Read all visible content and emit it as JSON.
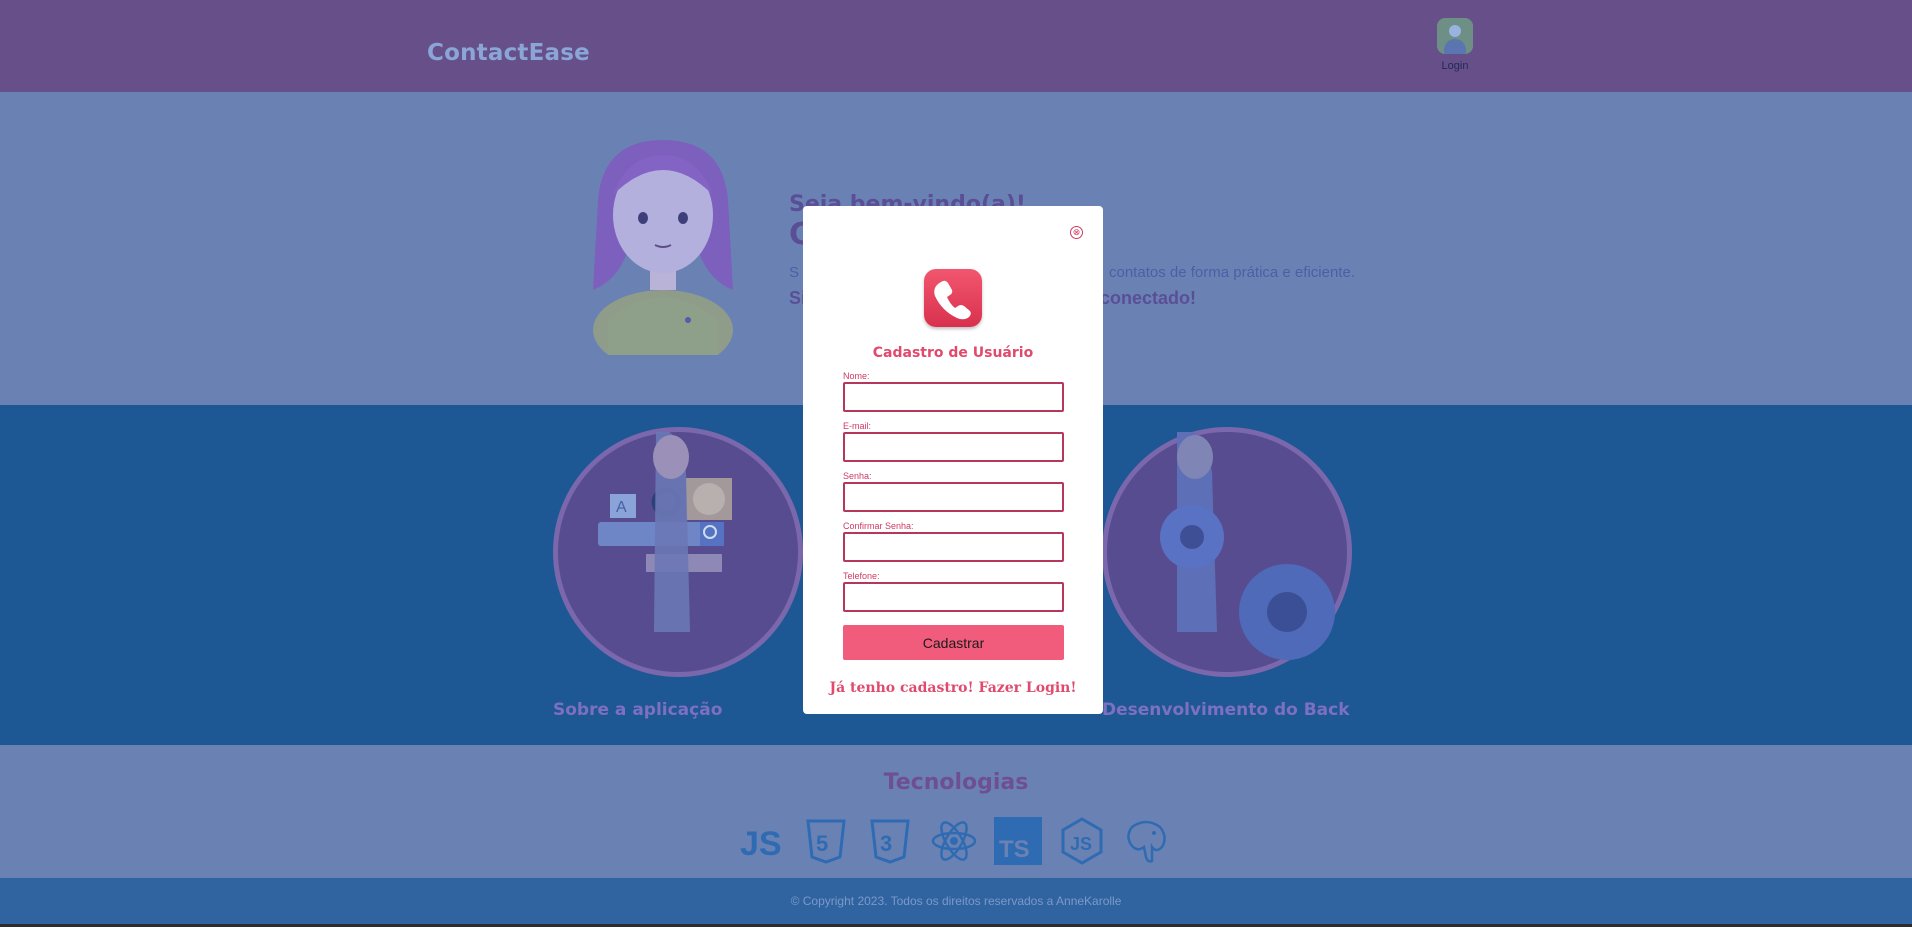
{
  "header": {
    "brand": "ContactEase",
    "login_label": "Login"
  },
  "hero": {
    "title_line1": "Seja bem-vindo(a)!",
    "title_line2": "C",
    "description_left": "S",
    "description_right": "contatos de forma prática e eficiente.",
    "strong_left": "Si",
    "strong_right": "conectado!"
  },
  "cards": [
    {
      "title": "Sobre a aplicação"
    },
    {
      "title": "Desenvolvimento do Back"
    }
  ],
  "tech": {
    "title": "Tecnologias",
    "icons": [
      "javascript-icon",
      "html5-icon",
      "css3-icon",
      "react-icon",
      "typescript-icon",
      "nodejs-icon",
      "postgresql-icon"
    ]
  },
  "footer": {
    "copyright": "© Copyright 2023. Todos os direitos reservados a AnneKarolle"
  },
  "modal": {
    "title": "Cadastro de Usuário",
    "fields": [
      {
        "label": "Nome:",
        "value": ""
      },
      {
        "label": "E-mail:",
        "value": ""
      },
      {
        "label": "Senha:",
        "value": ""
      },
      {
        "label": "Confirmar Senha:",
        "value": ""
      },
      {
        "label": "Telefone:",
        "value": ""
      }
    ],
    "submit_label": "Cadastrar",
    "login_link": "Já tenho cadastro! Fazer Login!",
    "close_symbol": "⊗"
  },
  "colors": {
    "header_bg": "#674f8a",
    "hero_bg": "#6a82b3",
    "cards_bg": "#1d5894",
    "accent_pink": "#f25c7c",
    "modal_title": "#e04a6c"
  }
}
